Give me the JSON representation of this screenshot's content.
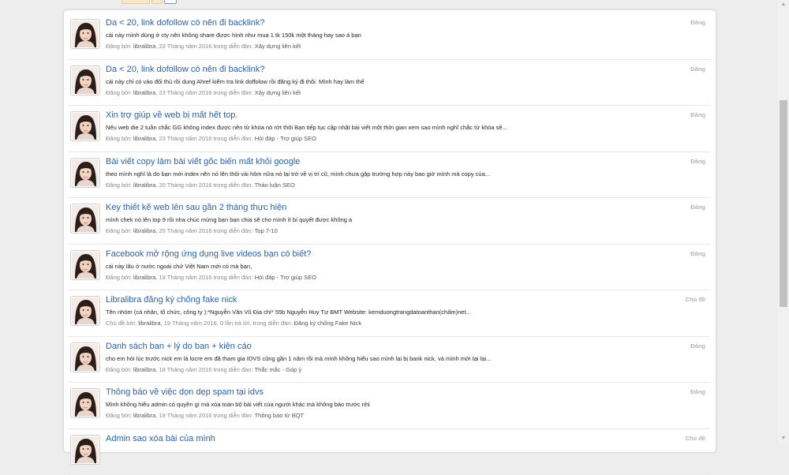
{
  "results": [
    {
      "title": "Da < 20, link dofollow có nên đi backlink?",
      "snippet": "cái này mình dùng ở cty nên không share được hình như mua 1 tk 150k một tháng hay sao á bạn",
      "meta_prefix": "Đăng bởi:",
      "user": "libralibra",
      "meta_middle": ", 23 Tháng năm 2016 trong diễn đàn:",
      "forum": "Xây dựng liên kết",
      "badge": "Đăng"
    },
    {
      "title": "Da < 20, link dofollow có nên đi backlink?",
      "snippet": "cái này chỉ có vào đối thủ rồi dung Ahref kiểm tra link doffolow rồi đăng ký đi thôi. Mình hay làm thế",
      "meta_prefix": "Đăng bởi:",
      "user": "libralibra",
      "meta_middle": ", 23 Tháng năm 2016 trong diễn đàn:",
      "forum": "Xây dựng liên kết",
      "badge": "Đăng"
    },
    {
      "title": "Xin trợ giúp về web bị mất hết top.",
      "snippet": "Nếu web die 2 tuần chắc GG không index được nên từ khóa nó rớt thôi Bạn tiếp tục cập nhật bài viết một thời gian xem sao mình nghĩ chắc từ khóa sẽ...",
      "meta_prefix": "Đăng bởi:",
      "user": "libralibra",
      "meta_middle": ", 23 Tháng năm 2016 trong diễn đàn:",
      "forum": "Hỏi đáp - Trợ giúp SEO",
      "badge": "Đăng"
    },
    {
      "title": "Bài viết copy làm bài viết gốc biến mất khỏi google",
      "snippet": "theo mình nghĩ là do bạn mới index nên nó lên thôi vài hôm nữa nó lại trở về vị trí cũ, mình chưa gặp trường hợp này bao giờ mình mà copy của...",
      "meta_prefix": "Đăng bởi:",
      "user": "libralibra",
      "meta_middle": ", 20 Tháng năm 2016 trong diễn đàn:",
      "forum": "Thảo luận SEO",
      "badge": "Đăng"
    },
    {
      "title": "Key thiết kế web lên sau gần 2 tháng thực hiện",
      "snippet": "mình chek nó lên top 9 rồi nha chúc mừng bạn bạn chia sẽ cho mình ít bí quyết được không a",
      "meta_prefix": "Đăng bởi:",
      "user": "libralibra",
      "meta_middle": ", 20 Tháng năm 2016 trong diễn đàn:",
      "forum": "Top 7-10",
      "badge": "Đăng"
    },
    {
      "title": "Facebook mở rộng ứng dụng live videos bạn có biết?",
      "snippet": "cái này lâu ở nước ngoài chứ Việt Nam mới có mà bạn,",
      "meta_prefix": "Đăng bởi:",
      "user": "libralibra",
      "meta_middle": ", 19 Tháng năm 2016 trong diễn đàn:",
      "forum": "Hỏi đáp - Trợ giúp SEO",
      "badge": "Đăng"
    },
    {
      "title": "Libralibra đăng ký chống fake nick",
      "snippet": "Tên nhóm (cá nhân, tổ chức, công ty ):*Nguyễn Văn Vũ Địa chỉ* 55b Nguyễn Huy Tự BMT Website: kemduongtrangdatoanthan(chấm)net...",
      "meta_prefix": "Chủ đề bởi:",
      "user": "libralibra",
      "meta_middle": ", 19 Tháng năm 2016, 0 lần trả lời, trong diễn đàn:",
      "forum": "Đăng ký chống Fake Nick",
      "badge": "Chủ đề"
    },
    {
      "title": "Danh sách ban + lý do ban + kiện cáo",
      "snippet": "cho em hỏi lúc trước nick em là locre em đã tham gia IDVS cũng gần 1 năm rồi mà mình không hiểu sao mình lại bị bank nick, và mình mới tại lại...",
      "meta_prefix": "Đăng bởi:",
      "user": "libralibra",
      "meta_middle": ", 18 Tháng năm 2016 trong diễn đàn:",
      "forum": "Thắc mắc - Góp ý",
      "badge": "Đăng"
    },
    {
      "title": "Thông báo về việc dọn dẹp spam tại idvs",
      "snippet": "Mình không hiểu admin có quyền gì mà xóa toàn bộ bài viết của người khác mà không báo trước nhỉ",
      "meta_prefix": "Đăng bởi:",
      "user": "libralibra",
      "meta_middle": ", 18 Tháng năm 2016 trong diễn đàn:",
      "forum": "Thông báo từ BQT",
      "badge": "Đăng"
    },
    {
      "title": "Admin sao xóa bài của mình",
      "snippet": "",
      "meta_prefix": "",
      "user": "",
      "meta_middle": "",
      "forum": "",
      "badge": "Chủ đề"
    }
  ]
}
